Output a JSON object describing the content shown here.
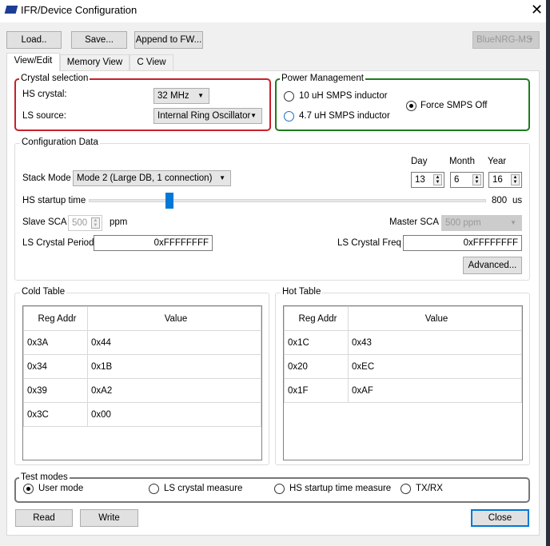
{
  "title": "IFR/Device Configuration",
  "toolbar": {
    "load": "Load..",
    "save": "Save...",
    "append": "Append to FW...",
    "device": "BlueNRG-MS"
  },
  "tabs": [
    "View/Edit",
    "Memory View",
    "C View"
  ],
  "crystal": {
    "title": "Crystal selection",
    "hs_label": "HS crystal:",
    "hs_value": "32 MHz",
    "ls_label": "LS source:",
    "ls_value": "Internal Ring Oscillator"
  },
  "power": {
    "title": "Power Management",
    "opt1": "10 uH SMPS inductor",
    "opt2": "4.7 uH SMPS inductor",
    "opt3": "Force SMPS Off",
    "selected": "Force SMPS Off"
  },
  "config": {
    "title": "Configuration Data",
    "stack_label": "Stack Mode",
    "stack_value": "Mode 2 (Large DB, 1 connection)",
    "day_label": "Day",
    "month_label": "Month",
    "year_label": "Year",
    "day": "13",
    "month": "6",
    "year": "16",
    "hs_startup_label": "HS startup time",
    "hs_startup_value": "800",
    "hs_startup_unit": "us",
    "slave_sca_label": "Slave SCA",
    "slave_sca_value": "500",
    "slave_sca_unit": "ppm",
    "master_sca_label": "Master SCA",
    "master_sca_value": "500 ppm",
    "ls_period_label": "LS Crystal Period",
    "ls_period_value": "0xFFFFFFFF",
    "ls_freq_label": "LS Crystal Freq",
    "ls_freq_value": "0xFFFFFFFF",
    "advanced": "Advanced..."
  },
  "cold": {
    "title": "Cold Table",
    "headers": [
      "Reg Addr",
      "Value"
    ],
    "rows": [
      [
        "0x3A",
        "0x44"
      ],
      [
        "0x34",
        "0x1B"
      ],
      [
        "0x39",
        "0xA2"
      ],
      [
        "0x3C",
        "0x00"
      ]
    ]
  },
  "hot": {
    "title": "Hot Table",
    "headers": [
      "Reg Addr",
      "Value"
    ],
    "rows": [
      [
        "0x1C",
        "0x43"
      ],
      [
        "0x20",
        "0xEC"
      ],
      [
        "0x1F",
        "0xAF"
      ]
    ]
  },
  "test": {
    "title": "Test modes",
    "modes": [
      "User mode",
      "LS crystal measure",
      "HS startup time measure",
      "TX/RX"
    ],
    "selected": "User mode"
  },
  "footer": {
    "read": "Read",
    "write": "Write",
    "close": "Close"
  }
}
